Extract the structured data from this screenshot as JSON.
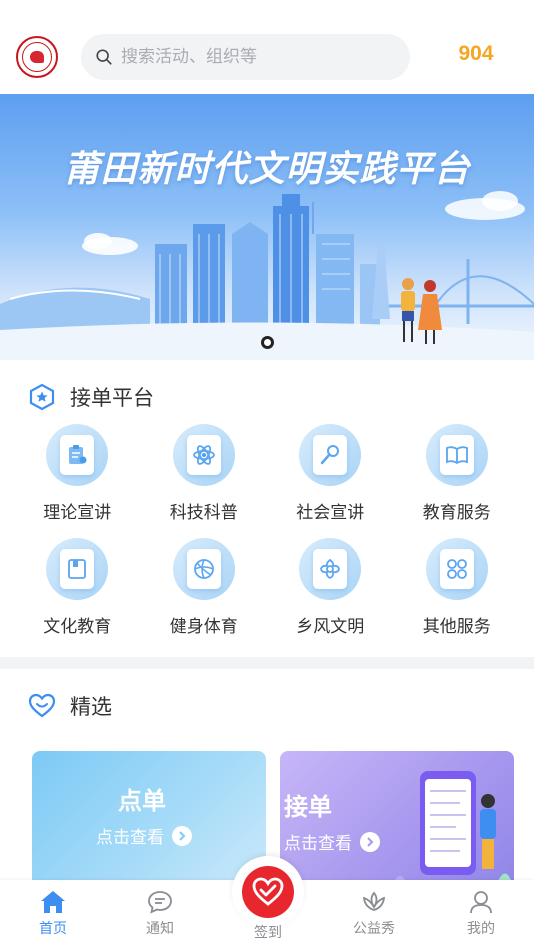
{
  "header": {
    "search_placeholder": "搜索活动、组织等",
    "count": "904"
  },
  "banner": {
    "title": "莆田新时代文明实践平台"
  },
  "platform": {
    "title": "接单平台",
    "items": [
      {
        "label": "理论宣讲",
        "icon": "clipboard-icon"
      },
      {
        "label": "科技科普",
        "icon": "atom-icon"
      },
      {
        "label": "社会宣讲",
        "icon": "microphone-icon"
      },
      {
        "label": "教育服务",
        "icon": "book-icon"
      },
      {
        "label": "文化教育",
        "icon": "notebook-icon"
      },
      {
        "label": "健身体育",
        "icon": "ball-icon"
      },
      {
        "label": "乡风文明",
        "icon": "flower-icon"
      },
      {
        "label": "其他服务",
        "icon": "four-petal-icon"
      }
    ]
  },
  "featured": {
    "title": "精选",
    "cards": [
      {
        "title": "点单",
        "subtitle": "点击查看"
      },
      {
        "title": "接单",
        "subtitle": "点击查看"
      }
    ]
  },
  "tabbar": {
    "items": [
      {
        "label": "首页",
        "icon": "home-icon",
        "active": true
      },
      {
        "label": "通知",
        "icon": "message-icon",
        "active": false
      },
      {
        "label": "签到",
        "icon": "heart-hand-icon",
        "active": false
      },
      {
        "label": "公益秀",
        "icon": "lotus-icon",
        "active": false
      },
      {
        "label": "我的",
        "icon": "user-icon",
        "active": false
      }
    ]
  },
  "colors": {
    "accent": "#3d8ef0",
    "count": "#f5a623",
    "signin": "#e8262e"
  }
}
